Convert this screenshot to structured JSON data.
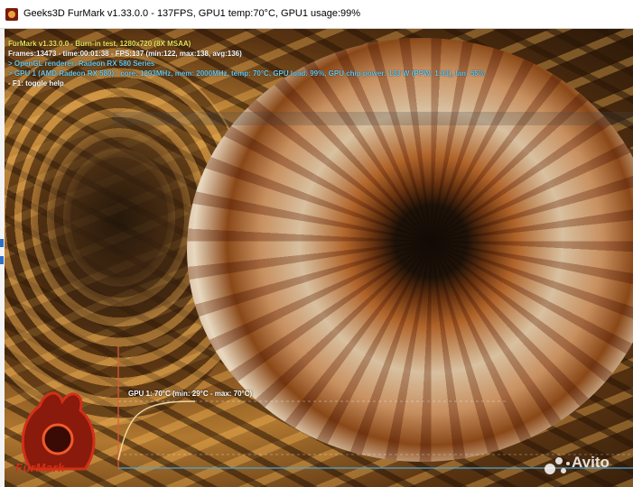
{
  "window": {
    "title": "Geeks3D FurMark v1.33.0.0 - 137FPS, GPU1 temp:70°C, GPU1 usage:99%",
    "icon": "furmark-app-icon"
  },
  "overlay": {
    "title_line": "FurMark v1.33.0.0 - Burn-in test, 1280x720 (8X MSAA)",
    "frames_line": "Frames:13473 - time:00:01:38 - FPS:137 (min:122, max:138, avg:136)",
    "renderer_line": "> OpenGL renderer: Radeon RX 580 Series",
    "gpu_line": "> GPU 1 (AMD Radeon RX 580) - core: 1203MHz, mem: 2000MHz, temp: 70°C, GPU load: 99%, GPU chip power: 133 W (PPW: 1.03), fan: 55%",
    "help_line": "- F1: toggle help"
  },
  "temp_graph": {
    "label": "GPU 1: 70°C (min: 29°C - max: 70°C)",
    "line_color": "#f2d9a0",
    "axis_color": "#e05a3a",
    "baseline_color": "#4aa8d8"
  },
  "logo": {
    "text": "FurMark",
    "icon": "furmark-logo-icon",
    "color": "#d23018"
  },
  "watermark": {
    "text": "Avito",
    "icon": "avito-dots-icon"
  }
}
